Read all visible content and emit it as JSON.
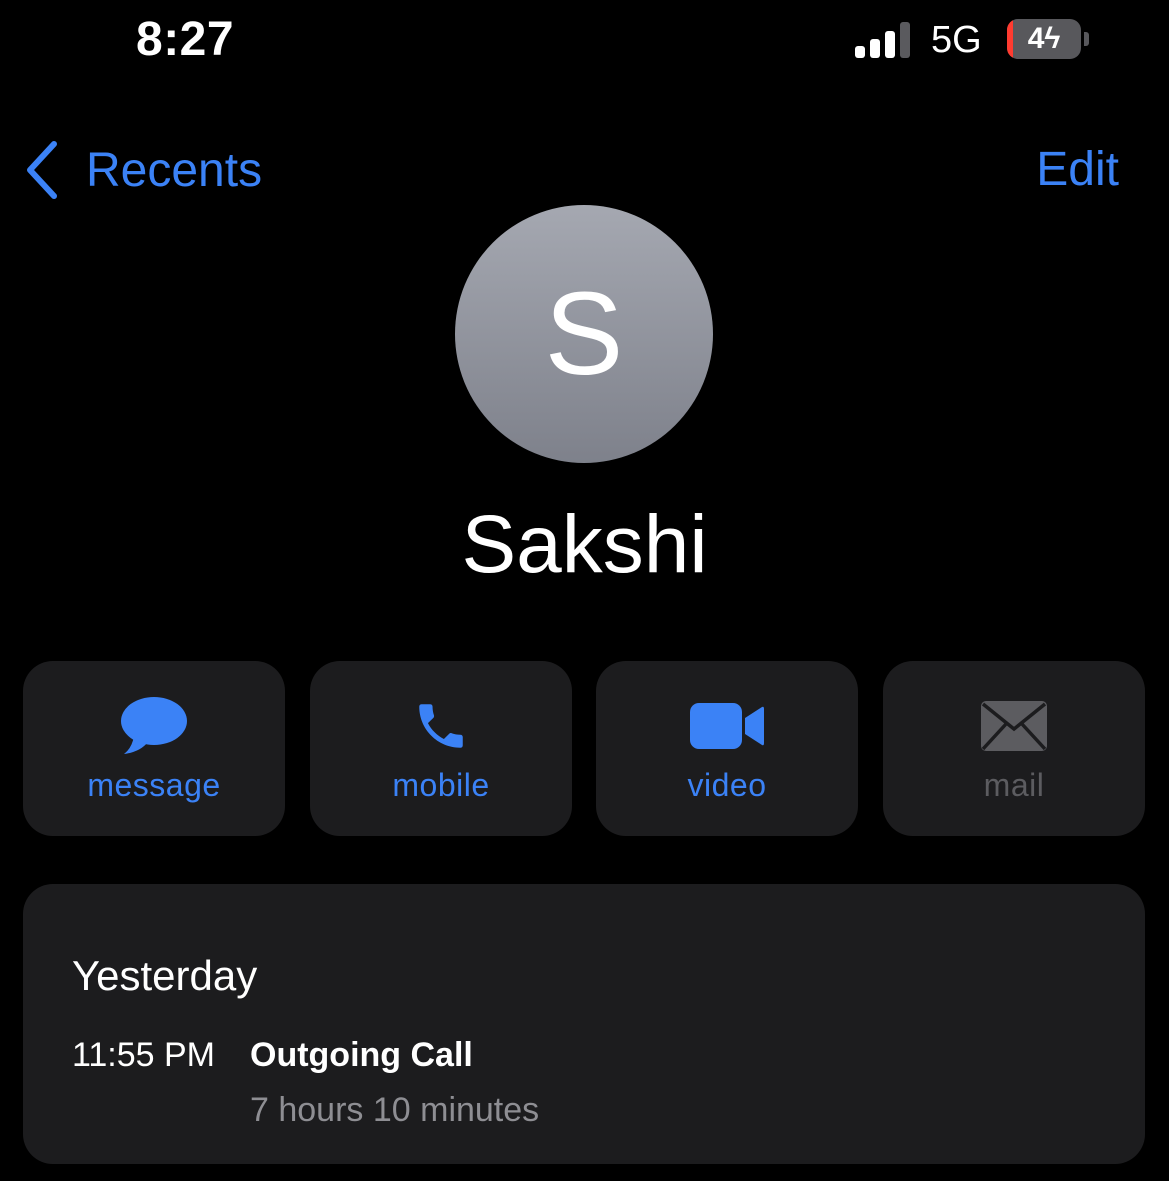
{
  "status_bar": {
    "time": "8:27",
    "network": "5G",
    "battery_level": "4",
    "battery_charging": true,
    "signal_icon": "cellular-signal-icon",
    "battery_icon": "battery-charging-icon"
  },
  "nav": {
    "back_label": "Recents",
    "back_icon": "chevron-left-icon",
    "edit_label": "Edit"
  },
  "contact": {
    "initial": "S",
    "name": "Sakshi"
  },
  "actions": [
    {
      "label": "message",
      "icon": "message-bubble-icon",
      "enabled": true
    },
    {
      "label": "mobile",
      "icon": "phone-icon",
      "enabled": true
    },
    {
      "label": "video",
      "icon": "video-camera-icon",
      "enabled": true
    },
    {
      "label": "mail",
      "icon": "envelope-icon",
      "enabled": false
    }
  ],
  "history": {
    "date": "Yesterday",
    "entries": [
      {
        "time": "11:55 PM",
        "type": "Outgoing Call",
        "duration": "7 hours 10 minutes"
      }
    ]
  },
  "colors": {
    "accent": "#3b82f6",
    "background": "#000000",
    "card": "#1c1c1e",
    "secondary_text": "#8e8e93",
    "disabled": "#5c5c60",
    "battery_low": "#ff3b30"
  }
}
